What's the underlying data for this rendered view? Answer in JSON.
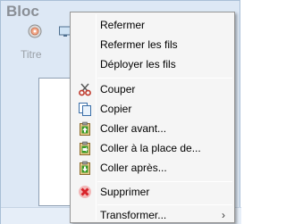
{
  "panel": {
    "title": "Bloc",
    "field_label": "Titre"
  },
  "menu": {
    "items": [
      {
        "label": "Refermer",
        "icon": null
      },
      {
        "label": "Refermer les fils",
        "icon": null
      },
      {
        "label": "Déployer les fils",
        "icon": null
      },
      {
        "label": "Couper",
        "icon": "scissors-icon"
      },
      {
        "label": "Copier",
        "icon": "copy-icon"
      },
      {
        "label": "Coller avant...",
        "icon": "paste-before-icon"
      },
      {
        "label": "Coller à la place de...",
        "icon": "paste-replace-icon"
      },
      {
        "label": "Coller après...",
        "icon": "paste-after-icon"
      },
      {
        "label": "Supprimer",
        "icon": "delete-icon"
      },
      {
        "label": "Transformer...",
        "icon": null,
        "submenu": true
      }
    ],
    "submenu_arrow": "›"
  },
  "colors": {
    "panel_bg": "#dde8f5",
    "menu_bg": "#f5f5f5",
    "paste_green": "#3a9a2a",
    "delete_red": "#d8232a"
  }
}
